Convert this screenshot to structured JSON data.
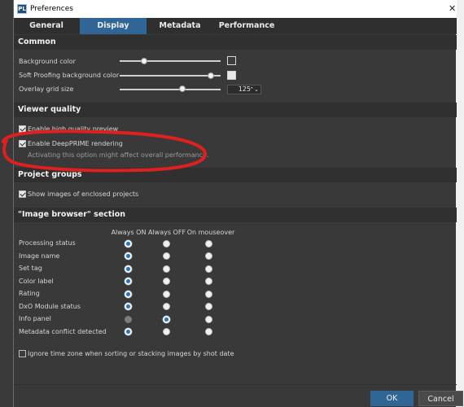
{
  "window": {
    "title": "Preferences",
    "app_icon_text": "PL"
  },
  "tabs": [
    "General",
    "Display",
    "Metadata",
    "Performance"
  ],
  "active_tab": "Display",
  "common": {
    "header": "Common",
    "background_color_label": "Background color",
    "soft_proofing_label": "Soft Proofing background color",
    "overlay_grid_label": "Overlay grid size",
    "overlay_grid_value": "125",
    "background_color_swatch": "#3d3d3d",
    "soft_proofing_swatch": "#e8e8e8"
  },
  "viewer_quality": {
    "header": "Viewer quality",
    "high_quality_label": "Enable high quality preview",
    "deepprime_label": "Enable DeepPRIME rendering",
    "deepprime_hint": "Activating this option might affect overall performance."
  },
  "project_groups": {
    "header": "Project groups",
    "show_images_label": "Show images of enclosed projects"
  },
  "image_browser": {
    "header": "\"Image browser\" section",
    "columns": [
      "Always ON",
      "Always OFF",
      "On mouseover"
    ],
    "rows": [
      {
        "label": "Processing status",
        "selected": 0
      },
      {
        "label": "Image name",
        "selected": 0
      },
      {
        "label": "Set tag",
        "selected": 0
      },
      {
        "label": "Color label",
        "selected": 0
      },
      {
        "label": "Rating",
        "selected": 0
      },
      {
        "label": "DxO Module status",
        "selected": 0
      },
      {
        "label": "Info panel",
        "selected": 1,
        "disabled": [
          0
        ]
      },
      {
        "label": "Metadata conflict detected",
        "selected": 0
      }
    ],
    "timezone_label": "Ignore time zone when sorting or stacking images by shot date"
  },
  "buttons": {
    "ok": "OK",
    "cancel": "Cancel"
  },
  "colors": {
    "accent": "#2f6696",
    "annotation": "#e0201f"
  }
}
